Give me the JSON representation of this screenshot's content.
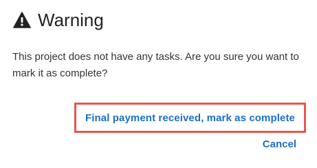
{
  "dialog": {
    "icon": "warning-triangle-icon",
    "title": "Warning",
    "message": "This project does not have any tasks. Are you sure you want to mark it as complete?",
    "primary_action_label": "Final payment received, mark as complete",
    "cancel_label": "Cancel"
  },
  "colors": {
    "link": "#1d6fc2",
    "highlight_border": "#e8564c",
    "text": "#333333"
  }
}
